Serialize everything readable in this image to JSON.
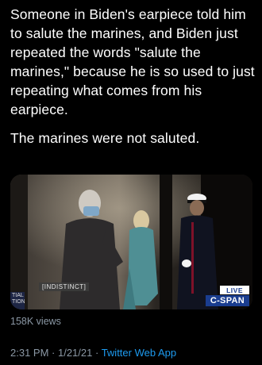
{
  "tweet": {
    "paragraphs": [
      "Someone in Biden's earpiece told him to salute the marines, and Biden just repeated the words \"salute the marines,\" because he is so used to just repeating what comes from his earpiece.",
      "The marines were not saluted."
    ]
  },
  "media": {
    "caption_tag": "[INDISTINCT]",
    "live_badge": "LIVE",
    "network_logo": "C-SPAN",
    "lower_third": "TIAL\nTION"
  },
  "stats": {
    "views": "158K views"
  },
  "meta": {
    "time": "2:31 PM",
    "date": "1/21/21",
    "separator": " · ",
    "app": "Twitter Web App"
  },
  "colors": {
    "background": "#000000",
    "text": "#ffffff",
    "secondary_text": "#8b98a5",
    "link": "#1d9bf0"
  }
}
